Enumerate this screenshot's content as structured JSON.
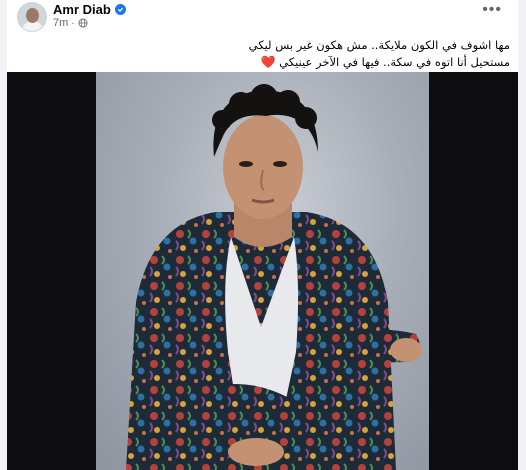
{
  "post": {
    "author": "Amr Diab",
    "time": "7m",
    "more_label": "•••",
    "text_line1": "مها اشوف في الكون ملايكة.. مش هكون غير بس ليكي",
    "text_line2": "مستحيل أنا اتوه في سكة.. فيها في الآخر عينيكي",
    "heart": "❤️"
  },
  "colors": {
    "verified": "#1877f2",
    "background": "#ffffff",
    "photo_backdrop": "#0d0d10"
  },
  "icons": [
    "avatar",
    "verified-badge-icon",
    "globe-icon",
    "more-options-icon",
    "red-heart-emoji"
  ]
}
